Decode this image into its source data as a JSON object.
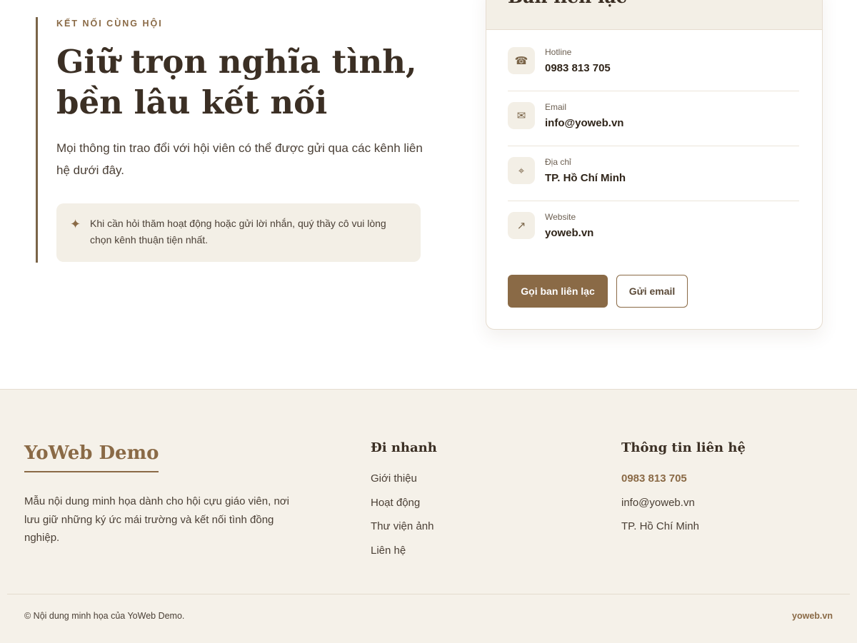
{
  "hero": {
    "eyebrow": "KẾT NỐI CÙNG HỘI",
    "title_line1": "Giữ trọn nghĩa tình,",
    "title_line2": "bền lâu kết nối",
    "description": "Mọi thông tin trao đổi với hội viên có thể được gửi qua các kênh liên hệ dưới đây.",
    "note": "Khi cần hỏi thăm hoạt động hoặc gửi lời nhắn, quý thầy cô vui lòng chọn kênh thuận tiện nhất.",
    "note_icon": "✦"
  },
  "contact_card": {
    "title": "Ban liên lạc",
    "items": [
      {
        "label": "Hotline",
        "value": "0983 813 705",
        "icon": "☎"
      },
      {
        "label": "Email",
        "value": "info@yoweb.vn",
        "icon": "✉"
      },
      {
        "label": "Địa chỉ",
        "value": "TP. Hồ Chí Minh",
        "icon": "⌖"
      },
      {
        "label": "Website",
        "value": "yoweb.vn",
        "icon": "↗"
      }
    ],
    "primary_button": "Gọi ban liên lạc",
    "secondary_button": "Gửi email"
  },
  "footer": {
    "brand": "YoWeb Demo",
    "brand_description": "Mẫu nội dung minh họa dành cho hội cựu giáo viên, nơi lưu giữ những ký ức mái trường và kết nối tình đồng nghiệp.",
    "quick_links_title": "Đi nhanh",
    "quick_links": [
      "Giới thiệu",
      "Hoạt động",
      "Thư viện ảnh",
      "Liên hệ"
    ],
    "contact_title": "Thông tin liên hệ",
    "contact_lines": [
      "0983 813 705",
      "info@yoweb.vn",
      "TP. Hồ Chí Minh"
    ],
    "copyright": "© Nội dung minh họa của YoWeb Demo.",
    "site": "yoweb.vn"
  }
}
